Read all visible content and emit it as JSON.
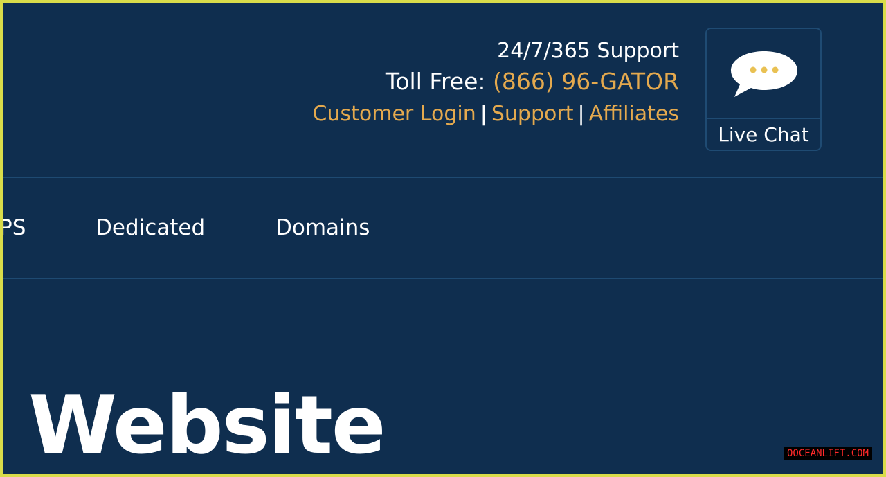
{
  "header": {
    "support_hours": "24/7/365 Support",
    "toll_free_label": "Toll Free: ",
    "toll_free_number": "(866) 96-GATOR",
    "links": {
      "customer_login": "Customer Login",
      "support": "Support",
      "affiliates": "Affiliates",
      "separator": "|"
    },
    "live_chat": {
      "label": "Live Chat",
      "icon": "chat-bubble-icon"
    }
  },
  "nav": {
    "items": [
      {
        "label": "PS"
      },
      {
        "label": "Dedicated"
      },
      {
        "label": "Domains"
      }
    ]
  },
  "hero": {
    "title": "l Website"
  },
  "watermark": {
    "text": "OOCEANLIFT.COM"
  },
  "colors": {
    "background": "#0f2e4f",
    "accent": "#e4a94e",
    "border": "#d9dc4a",
    "text": "#ffffff"
  }
}
